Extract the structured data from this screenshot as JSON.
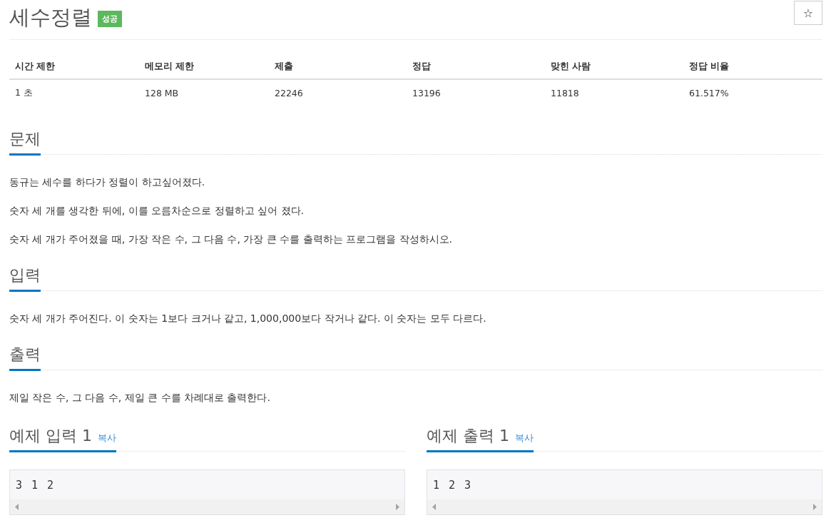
{
  "problem": {
    "title": "세수정렬",
    "badge": "성공",
    "star_button": "☆"
  },
  "info_table": {
    "columns": [
      "시간 제한",
      "메모리 제한",
      "제출",
      "정답",
      "맞힌 사람",
      "정답 비율"
    ],
    "rows": [
      [
        "1 초",
        "128 MB",
        "22246",
        "13196",
        "11818",
        "61.517%"
      ]
    ]
  },
  "sections": [
    {
      "heading": "문제",
      "paragraphs": [
        "동규는 세수를 하다가 정렬이 하고싶어졌다.",
        "숫자 세 개를 생각한 뒤에, 이를 오름차순으로 정렬하고 싶어 졌다.",
        "숫자 세 개가 주어졌을 때, 가장 작은 수, 그 다음 수, 가장 큰 수를 출력하는 프로그램을 작성하시오."
      ]
    },
    {
      "heading": "입력",
      "paragraphs": [
        "숫자 세 개가 주어진다. 이 숫자는 1보다 크거나 같고, 1,000,000보다 작거나 같다. 이 숫자는 모두 다르다."
      ]
    },
    {
      "heading": "출력",
      "paragraphs": [
        "제일 작은 수, 그 다음 수, 제일 큰 수를 차례대로 출력한다."
      ]
    }
  ],
  "examples": [
    {
      "heading": "예제 입력 1",
      "copy_link": "복사",
      "content": "3 1 2"
    },
    {
      "heading": "예제 출력 1",
      "copy_link": "복사",
      "content": "1 2 3"
    }
  ]
}
